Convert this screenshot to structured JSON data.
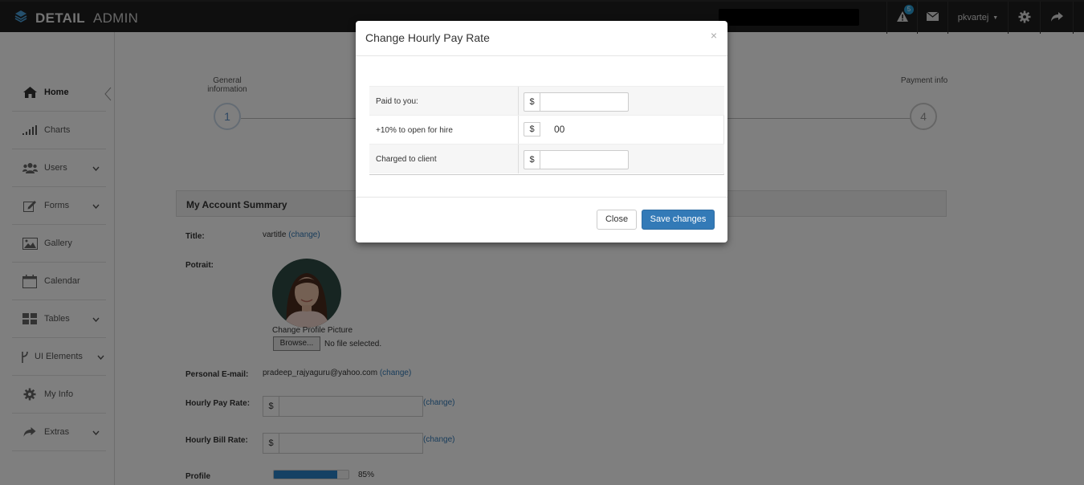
{
  "brand": {
    "bold": "DETAIL",
    "light": "ADMIN"
  },
  "topbar": {
    "alert_count": "5",
    "username": "pkvartej"
  },
  "sidebar": {
    "items": [
      {
        "label": "Home"
      },
      {
        "label": "Charts"
      },
      {
        "label": "Users"
      },
      {
        "label": "Forms"
      },
      {
        "label": "Gallery"
      },
      {
        "label": "Calendar"
      },
      {
        "label": "Tables"
      },
      {
        "label": "UI Elements"
      },
      {
        "label": "My Info"
      },
      {
        "label": "Extras"
      }
    ]
  },
  "wizard": {
    "step1_label": "General information",
    "step1_number": "1",
    "step4_label": "Payment info",
    "step4_number": "4"
  },
  "account": {
    "heading": "My Account Summary",
    "title_label": "Title:",
    "title_value": "vartitle",
    "change": "(change)",
    "potrait_label": "Potrait:",
    "change_picture": "Change Profile Picture",
    "browse": "Browse...",
    "no_file": "No file selected.",
    "email_label": "Personal E-mail:",
    "email_value": "pradeep_rajyaguru@yahoo.com",
    "pay_rate_label": "Hourly Pay Rate:",
    "bill_rate_label": "Hourly Bill Rate:",
    "currency": "$",
    "profile_label": "Profile",
    "profile_percent": "85%",
    "profile_progress": 0.85
  },
  "modal": {
    "title": "Change Hourly Pay Rate",
    "close_x": "×",
    "rows": [
      {
        "label": "Paid to you:",
        "addon": "$"
      },
      {
        "label": "+10% to open for hire",
        "addon": "$",
        "value": "00"
      },
      {
        "label": "Charged to client",
        "addon": "$"
      }
    ],
    "close_button": "Close",
    "save_button": "Save changes"
  },
  "colors": {
    "primary": "#337ab7",
    "topbar": "#1e1e1e",
    "badge": "#2a9fd6"
  }
}
